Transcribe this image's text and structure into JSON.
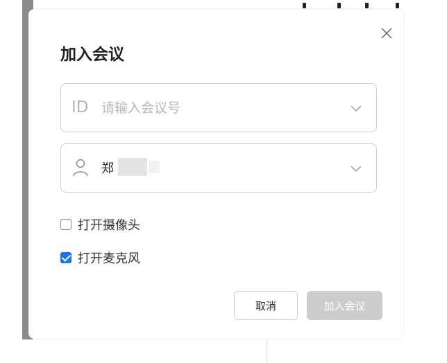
{
  "dialog": {
    "title": "加入会议",
    "close_icon": "close-icon"
  },
  "meeting_id": {
    "prefix": "ID",
    "value": "",
    "placeholder": "请输入会议号",
    "dropdown_icon": "chevron-down-icon"
  },
  "display_name": {
    "icon": "user-icon",
    "value": "郑",
    "dropdown_icon": "chevron-down-icon"
  },
  "options": {
    "camera": {
      "label": "打开摄像头",
      "checked": false
    },
    "microphone": {
      "label": "打开麦克风",
      "checked": true
    }
  },
  "buttons": {
    "cancel": "取消",
    "join": "加入会议"
  },
  "colors": {
    "accent": "#1d72f3",
    "disabled_button": "#cccccc"
  }
}
